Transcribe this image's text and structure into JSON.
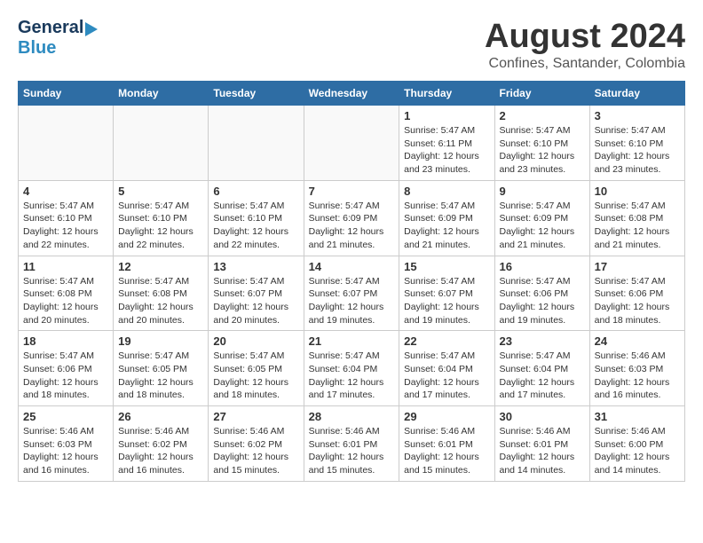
{
  "header": {
    "logo_general": "General",
    "logo_blue": "Blue",
    "title": "August 2024",
    "subtitle": "Confines, Santander, Colombia"
  },
  "calendar": {
    "days_of_week": [
      "Sunday",
      "Monday",
      "Tuesday",
      "Wednesday",
      "Thursday",
      "Friday",
      "Saturday"
    ],
    "weeks": [
      [
        {
          "day": "",
          "info": ""
        },
        {
          "day": "",
          "info": ""
        },
        {
          "day": "",
          "info": ""
        },
        {
          "day": "",
          "info": ""
        },
        {
          "day": "1",
          "info": "Sunrise: 5:47 AM\nSunset: 6:11 PM\nDaylight: 12 hours\nand 23 minutes."
        },
        {
          "day": "2",
          "info": "Sunrise: 5:47 AM\nSunset: 6:10 PM\nDaylight: 12 hours\nand 23 minutes."
        },
        {
          "day": "3",
          "info": "Sunrise: 5:47 AM\nSunset: 6:10 PM\nDaylight: 12 hours\nand 23 minutes."
        }
      ],
      [
        {
          "day": "4",
          "info": "Sunrise: 5:47 AM\nSunset: 6:10 PM\nDaylight: 12 hours\nand 22 minutes."
        },
        {
          "day": "5",
          "info": "Sunrise: 5:47 AM\nSunset: 6:10 PM\nDaylight: 12 hours\nand 22 minutes."
        },
        {
          "day": "6",
          "info": "Sunrise: 5:47 AM\nSunset: 6:10 PM\nDaylight: 12 hours\nand 22 minutes."
        },
        {
          "day": "7",
          "info": "Sunrise: 5:47 AM\nSunset: 6:09 PM\nDaylight: 12 hours\nand 21 minutes."
        },
        {
          "day": "8",
          "info": "Sunrise: 5:47 AM\nSunset: 6:09 PM\nDaylight: 12 hours\nand 21 minutes."
        },
        {
          "day": "9",
          "info": "Sunrise: 5:47 AM\nSunset: 6:09 PM\nDaylight: 12 hours\nand 21 minutes."
        },
        {
          "day": "10",
          "info": "Sunrise: 5:47 AM\nSunset: 6:08 PM\nDaylight: 12 hours\nand 21 minutes."
        }
      ],
      [
        {
          "day": "11",
          "info": "Sunrise: 5:47 AM\nSunset: 6:08 PM\nDaylight: 12 hours\nand 20 minutes."
        },
        {
          "day": "12",
          "info": "Sunrise: 5:47 AM\nSunset: 6:08 PM\nDaylight: 12 hours\nand 20 minutes."
        },
        {
          "day": "13",
          "info": "Sunrise: 5:47 AM\nSunset: 6:07 PM\nDaylight: 12 hours\nand 20 minutes."
        },
        {
          "day": "14",
          "info": "Sunrise: 5:47 AM\nSunset: 6:07 PM\nDaylight: 12 hours\nand 19 minutes."
        },
        {
          "day": "15",
          "info": "Sunrise: 5:47 AM\nSunset: 6:07 PM\nDaylight: 12 hours\nand 19 minutes."
        },
        {
          "day": "16",
          "info": "Sunrise: 5:47 AM\nSunset: 6:06 PM\nDaylight: 12 hours\nand 19 minutes."
        },
        {
          "day": "17",
          "info": "Sunrise: 5:47 AM\nSunset: 6:06 PM\nDaylight: 12 hours\nand 18 minutes."
        }
      ],
      [
        {
          "day": "18",
          "info": "Sunrise: 5:47 AM\nSunset: 6:06 PM\nDaylight: 12 hours\nand 18 minutes."
        },
        {
          "day": "19",
          "info": "Sunrise: 5:47 AM\nSunset: 6:05 PM\nDaylight: 12 hours\nand 18 minutes."
        },
        {
          "day": "20",
          "info": "Sunrise: 5:47 AM\nSunset: 6:05 PM\nDaylight: 12 hours\nand 18 minutes."
        },
        {
          "day": "21",
          "info": "Sunrise: 5:47 AM\nSunset: 6:04 PM\nDaylight: 12 hours\nand 17 minutes."
        },
        {
          "day": "22",
          "info": "Sunrise: 5:47 AM\nSunset: 6:04 PM\nDaylight: 12 hours\nand 17 minutes."
        },
        {
          "day": "23",
          "info": "Sunrise: 5:47 AM\nSunset: 6:04 PM\nDaylight: 12 hours\nand 17 minutes."
        },
        {
          "day": "24",
          "info": "Sunrise: 5:46 AM\nSunset: 6:03 PM\nDaylight: 12 hours\nand 16 minutes."
        }
      ],
      [
        {
          "day": "25",
          "info": "Sunrise: 5:46 AM\nSunset: 6:03 PM\nDaylight: 12 hours\nand 16 minutes."
        },
        {
          "day": "26",
          "info": "Sunrise: 5:46 AM\nSunset: 6:02 PM\nDaylight: 12 hours\nand 16 minutes."
        },
        {
          "day": "27",
          "info": "Sunrise: 5:46 AM\nSunset: 6:02 PM\nDaylight: 12 hours\nand 15 minutes."
        },
        {
          "day": "28",
          "info": "Sunrise: 5:46 AM\nSunset: 6:01 PM\nDaylight: 12 hours\nand 15 minutes."
        },
        {
          "day": "29",
          "info": "Sunrise: 5:46 AM\nSunset: 6:01 PM\nDaylight: 12 hours\nand 15 minutes."
        },
        {
          "day": "30",
          "info": "Sunrise: 5:46 AM\nSunset: 6:01 PM\nDaylight: 12 hours\nand 14 minutes."
        },
        {
          "day": "31",
          "info": "Sunrise: 5:46 AM\nSunset: 6:00 PM\nDaylight: 12 hours\nand 14 minutes."
        }
      ]
    ]
  }
}
